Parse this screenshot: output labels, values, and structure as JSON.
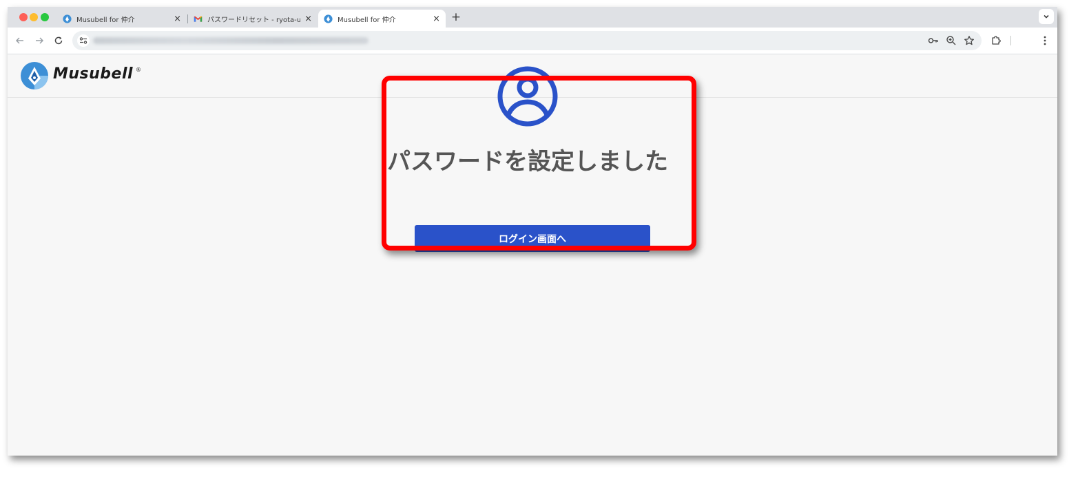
{
  "browser": {
    "tabs": [
      {
        "title": "Musubell for 仲介",
        "favicon": "musubell-icon",
        "active": false
      },
      {
        "title": "パスワードリセット - ryota-ujih",
        "favicon": "gmail-icon",
        "active": false
      },
      {
        "title": "Musubell for 仲介",
        "favicon": "musubell-icon",
        "active": true
      }
    ],
    "new_tab_label": "+",
    "close_glyph": "×"
  },
  "page": {
    "brand": "Musubell",
    "brand_mark": "®",
    "status_icon": "user-circle-icon",
    "message": "パスワードを設定しました",
    "login_button": "ログイン画面へ"
  },
  "colors": {
    "primary": "#2a52c9",
    "highlight": "#ff0000",
    "message": "#555555"
  }
}
